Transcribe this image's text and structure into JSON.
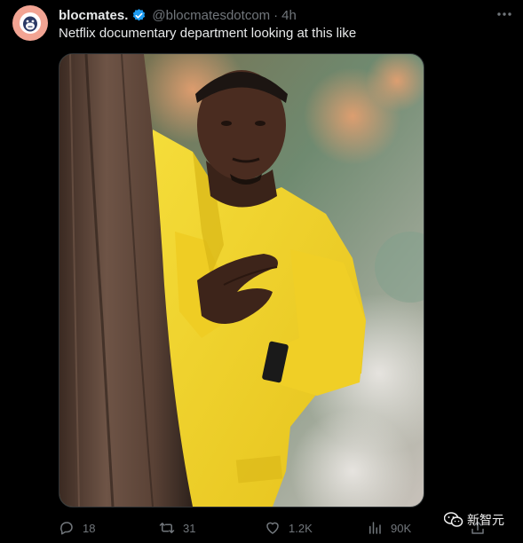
{
  "tweet": {
    "display_name": "blocmates.",
    "handle": "@blocmatesdotcom",
    "separator": "·",
    "time": "4h",
    "text": "Netflix documentary department looking at this like"
  },
  "actions": {
    "replies": "18",
    "reposts": "31",
    "likes": "1.2K",
    "views": "90K"
  },
  "watermark": {
    "text": "新智元"
  },
  "icons": {
    "verified": "verified-badge-icon",
    "more": "more-icon",
    "reply": "reply-icon",
    "repost": "repost-icon",
    "like": "heart-icon",
    "views": "views-icon",
    "share": "share-icon"
  },
  "colors": {
    "background": "#000000",
    "text": "#e7e9ea",
    "muted": "#71767b",
    "verified": "#1d9bf0",
    "avatar_bg": "#f2a493",
    "jacket": "#f2d52a"
  }
}
